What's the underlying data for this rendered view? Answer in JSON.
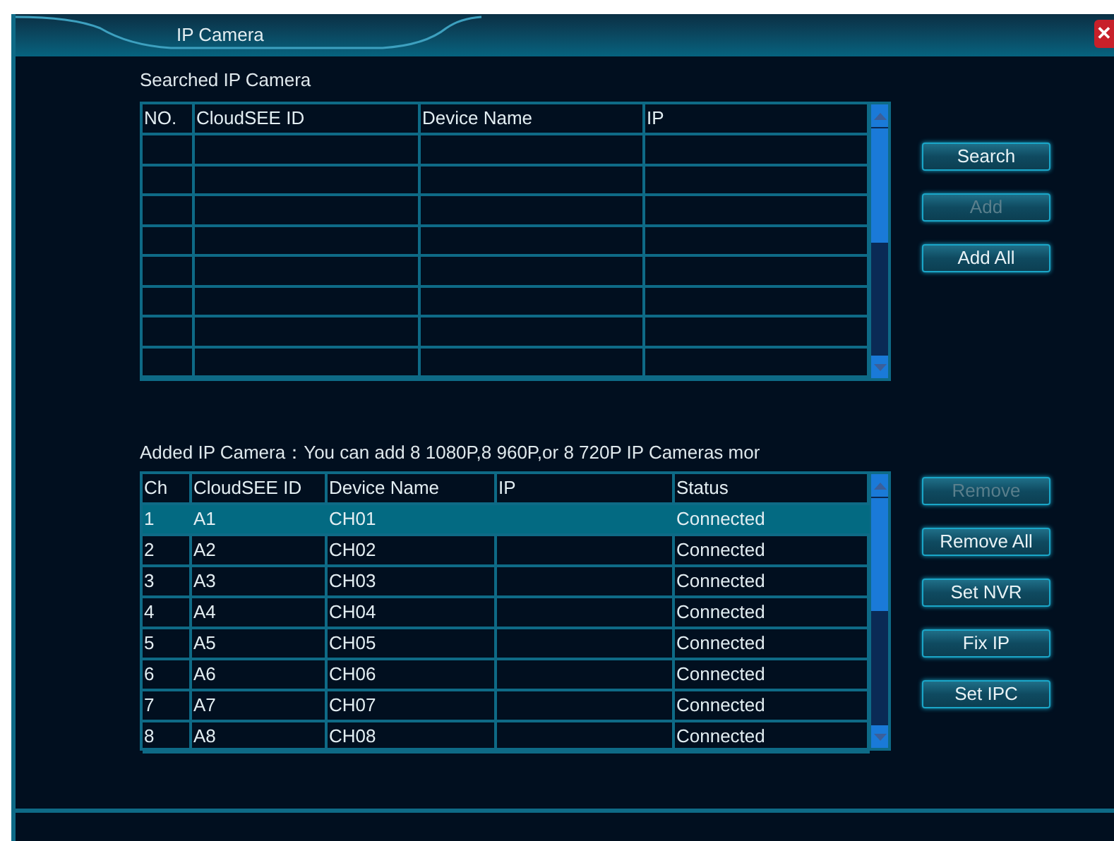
{
  "window": {
    "title": "IP Camera",
    "close": "✕"
  },
  "searched": {
    "label": "Searched IP Camera",
    "columns": [
      "NO.",
      "CloudSEE ID",
      "Device Name",
      "IP"
    ]
  },
  "search_buttons": [
    {
      "label": "Search",
      "disabled": false
    },
    {
      "label": "Add",
      "disabled": true
    },
    {
      "label": "Add All",
      "disabled": false
    }
  ],
  "added": {
    "label": "Added IP Camera：You can add 8 1080P,8 960P,or 8 720P IP Cameras mor",
    "columns": [
      "Ch",
      "CloudSEE ID",
      "Device Name",
      "IP",
      "Status"
    ],
    "rows": [
      {
        "cells": [
          "1",
          "A1",
          "CH01",
          "",
          "Connected"
        ],
        "selected": true
      },
      {
        "cells": [
          "2",
          "A2",
          "CH02",
          "",
          "Connected"
        ],
        "selected": false
      },
      {
        "cells": [
          "3",
          "A3",
          "CH03",
          "",
          "Connected"
        ],
        "selected": false
      },
      {
        "cells": [
          "4",
          "A4",
          "CH04",
          "",
          "Connected"
        ],
        "selected": false
      },
      {
        "cells": [
          "5",
          "A5",
          "CH05",
          "",
          "Connected"
        ],
        "selected": false
      },
      {
        "cells": [
          "6",
          "A6",
          "CH06",
          "",
          "Connected"
        ],
        "selected": false
      },
      {
        "cells": [
          "7",
          "A7",
          "CH07",
          "",
          "Connected"
        ],
        "selected": false
      },
      {
        "cells": [
          "8",
          "A8",
          "CH08",
          "",
          "Connected"
        ],
        "selected": false
      }
    ]
  },
  "added_buttons": [
    {
      "label": "Remove",
      "disabled": true
    },
    {
      "label": "Remove All",
      "disabled": false
    },
    {
      "label": "Set NVR",
      "disabled": false
    },
    {
      "label": "Fix IP",
      "disabled": false
    },
    {
      "label": "Set IPC",
      "disabled": false
    }
  ]
}
